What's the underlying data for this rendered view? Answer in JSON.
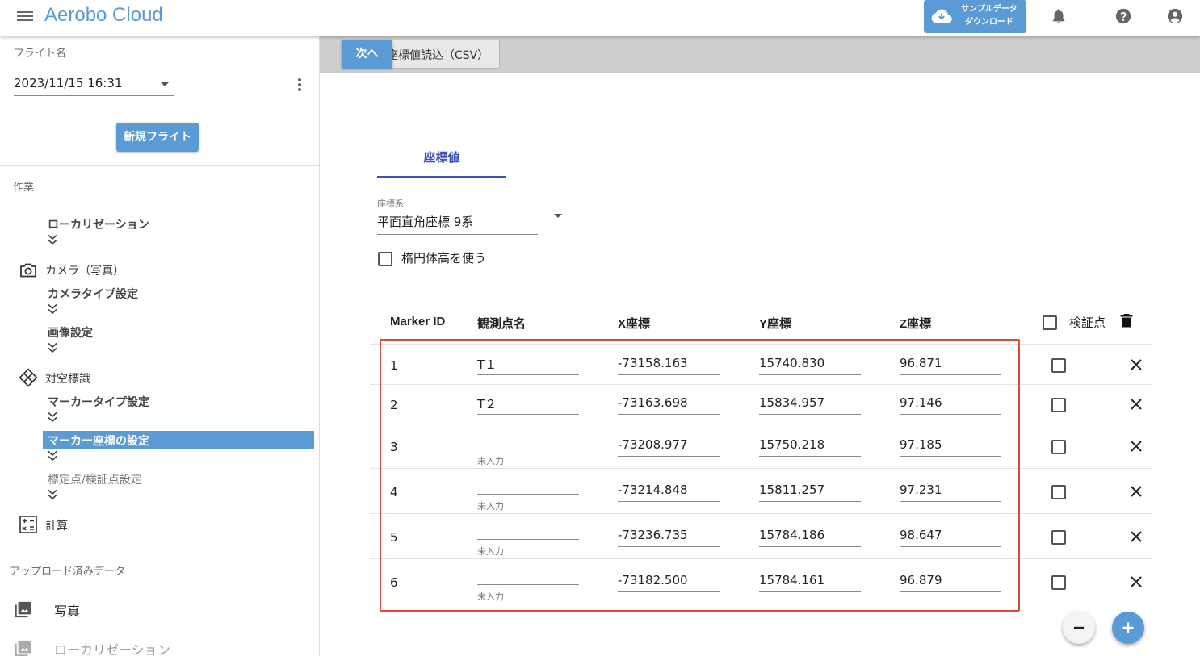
{
  "header": {
    "app_title": "Aerobo Cloud",
    "sample_download_line1": "サンプルデータ",
    "sample_download_line2": "ダウンロード",
    "accent_color": "#5b9bd5"
  },
  "sidebar": {
    "flight_name_label": "フライト名",
    "flight_selected": "2023/11/15 16:31",
    "new_flight_button": "新規フライト",
    "work_label": "作業",
    "localization": "ローカリゼーション",
    "camera_section": "カメラ（写真）",
    "camera_type_setting": "カメラタイプ設定",
    "image_setting": "画像設定",
    "aerial_marker_section": "対空標識",
    "marker_type_setting": "マーカータイプ設定",
    "marker_coord_setting": "マーカー座標の設定",
    "gcp_check_setting": "標定点/検証点設定",
    "calc_section": "計算",
    "uploaded_label": "アップロード済みデータ",
    "uploaded_items": [
      "写真",
      "ローカリゼーション"
    ]
  },
  "toolbar": {
    "next_button": "次へ",
    "csv_button": "座標値読込（CSV）"
  },
  "main": {
    "tab_label": "座標値",
    "crs_label": "座標系",
    "crs_value": "平面直角座標 9系",
    "ellipsoid_label": "楕円体高を使う",
    "ellipsoid_checked": false,
    "columns": {
      "marker_id": "Marker ID",
      "obs_name": "観測点名",
      "x": "X座標",
      "y": "Y座標",
      "z": "Z座標",
      "verify": "検証点"
    },
    "empty_helper": "未入力",
    "rows": [
      {
        "id": "1",
        "name": "T１",
        "x": "-73158.163",
        "y": "15740.830",
        "z": "96.871",
        "verify": false
      },
      {
        "id": "2",
        "name": "T２",
        "x": "-73163.698",
        "y": "15834.957",
        "z": "97.146",
        "verify": false
      },
      {
        "id": "3",
        "name": "",
        "x": "-73208.977",
        "y": "15750.218",
        "z": "97.185",
        "verify": false
      },
      {
        "id": "4",
        "name": "",
        "x": "-73214.848",
        "y": "15811.257",
        "z": "97.231",
        "verify": false
      },
      {
        "id": "5",
        "name": "",
        "x": "-73236.735",
        "y": "15784.186",
        "z": "98.647",
        "verify": false
      },
      {
        "id": "6",
        "name": "",
        "x": "-73182.500",
        "y": "15784.161",
        "z": "96.879",
        "verify": false
      }
    ]
  }
}
